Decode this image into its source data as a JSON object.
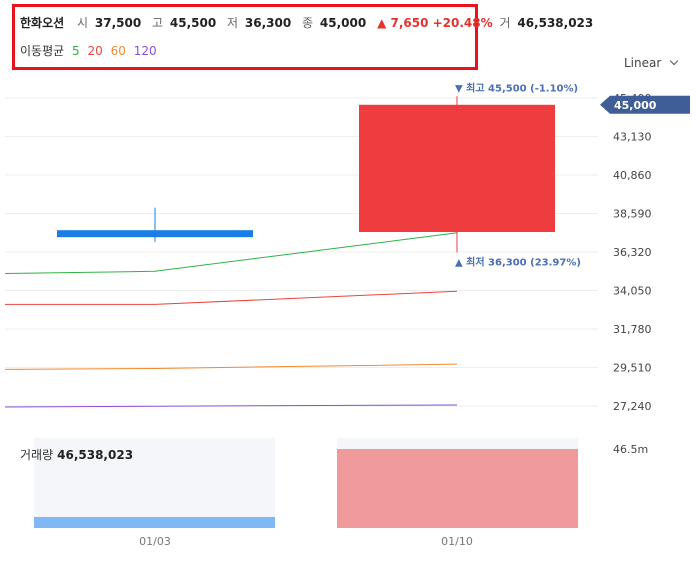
{
  "header": {
    "name": "한화오션",
    "open_label": "시",
    "open": "37,500",
    "high_label": "고",
    "high": "45,500",
    "low_label": "저",
    "low": "36,300",
    "close_label": "종",
    "close": "45,000",
    "change": "▲ 7,650 +20.48%",
    "volume_label": "거",
    "volume": "46,538,023"
  },
  "ma_legend": {
    "title": "이동평균",
    "items": [
      {
        "label": "5",
        "color": "#2fb344"
      },
      {
        "label": "20",
        "color": "#e8453c"
      },
      {
        "label": "60",
        "color": "#f08a32"
      },
      {
        "label": "120",
        "color": "#8a4fd8"
      }
    ]
  },
  "scale_button": "Linear",
  "volume_panel": {
    "label": "거래량",
    "value": "46,538,023",
    "axis_label": "46.5m"
  },
  "chart_data": {
    "type": "candlestick",
    "x_labels": [
      "01/03",
      "01/10"
    ],
    "price_axis": {
      "ticks": [
        "45,400",
        "43,130",
        "40,860",
        "38,590",
        "36,320",
        "34,050",
        "31,780",
        "29,510",
        "27,240"
      ],
      "tick_values": [
        45400,
        43130,
        40860,
        38590,
        36320,
        34050,
        31780,
        29510,
        27240
      ],
      "current_price_label": "45,000",
      "current_price": 45000
    },
    "candles": [
      {
        "x": "01/03",
        "open": 37400,
        "high": 38940,
        "low": 36920,
        "close": 37400,
        "color": "#1a7ee6"
      },
      {
        "x": "01/10",
        "open": 37500,
        "high": 45500,
        "low": 36300,
        "close": 45000,
        "color": "#ef3c3f"
      }
    ],
    "annotations": {
      "high": {
        "text": "▼ 최고 45,500 (-1.10%)",
        "value": 45500
      },
      "low": {
        "text": "▲ 최저 36,300 (23.97%)",
        "value": 36300
      }
    },
    "moving_averages": [
      {
        "period": "5",
        "color": "#2fb344",
        "values": [
          35050,
          35180,
          37450
        ]
      },
      {
        "period": "20",
        "color": "#e8453c",
        "values": [
          33230,
          33230,
          34000
        ]
      },
      {
        "period": "60",
        "color": "#f08a32",
        "values": [
          29400,
          29450,
          29710
        ]
      },
      {
        "period": "120",
        "color": "#8a4fd8",
        "values": [
          27180,
          27230,
          27300
        ]
      }
    ],
    "volume": [
      {
        "x": "01/03",
        "value": 6500000,
        "color": "#7fb8f5"
      },
      {
        "x": "01/10",
        "value": 46538023,
        "color": "#f09a9c"
      }
    ],
    "volume_max": 53000000
  }
}
